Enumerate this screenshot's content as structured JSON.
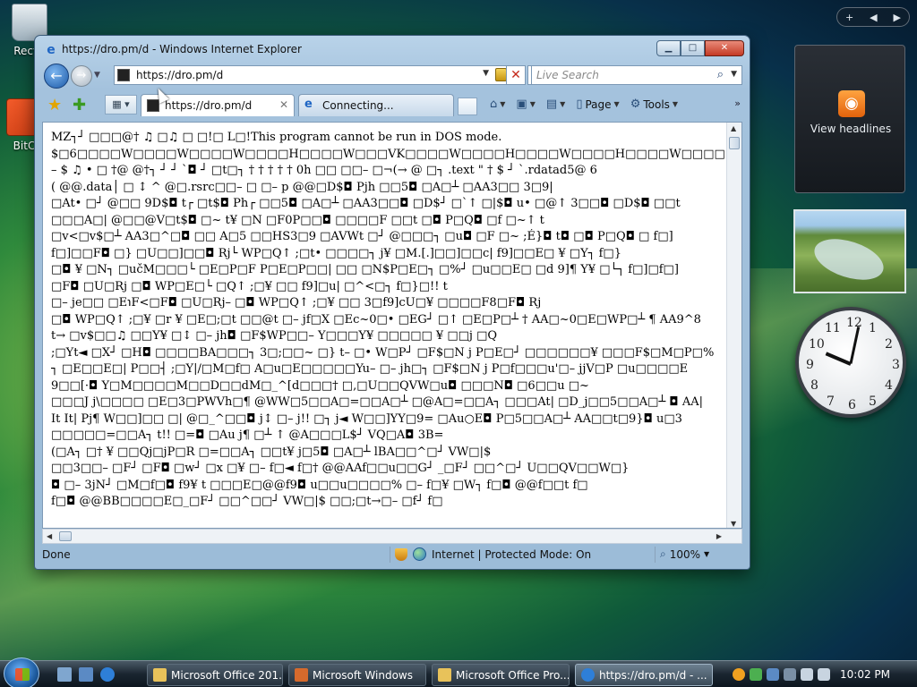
{
  "desktop": {
    "icons": [
      {
        "label": "Recyc"
      },
      {
        "label": "BitC"
      }
    ]
  },
  "ie": {
    "window_title": "https://dro.pm/d - Windows Internet Explorer",
    "address": "https://dro.pm/d",
    "search_placeholder": "Live Search",
    "tabs": [
      {
        "label": "https://dro.pm/d",
        "active": true
      },
      {
        "label": "Connecting...",
        "active": false
      }
    ],
    "commands": {
      "page": "Page",
      "tools": "Tools"
    },
    "status": {
      "text": "Done",
      "zone": "Internet | Protected Mode: On",
      "zoom": "100%"
    },
    "content_lines": [
      "MZ┐┘ □□□@†   ♫   □♫ □ □!□   L□!This program cannot be run in DOS mode.",
      "$□6□□□□W□□□□W□□□□W□□□□H□□□□W□□□VK□□□□W□□□□H□□□□W□□□□H□□□□W□□□□t□□□□W□□□□H□□□□V",
      "   – $   ♫ •  □     †@   @†┐ ┘ ┘ `◘ ┘ □t□┐ † † † † † 0h    □□    □□– □¬(→ @   □┐ .text   \"  † $   ┘  `.rdatad5@   6",
      "(   @@.data│  □   ↕ ^   @□.rsrc□□– □   □– p   @@□D$◘ Pjh   □□5◘  □A□┴  □AA3□□  3□9|",
      "□At• □┘  @□□   9D$◘ t┌ □t$◘ Ph┌ □□5◘  □A□┴  □AA3□□◘  □D$┘  □`↑ □|$◘ u• □@↑     3□□◘  □D$◘  □□t",
      "□□□A□|  @□□@V□t$◘ □~ t¥ □N    □F0P□□◘  □□□□F □□t □◘  P□Q◘   □f □~↑ t",
      "□v<□v$□┴    AA3□^□◘  □□    A□5     □□HS3□9     □AVWt □┘   @□□□┐  □u◘  □F □~ ;É}◘ t◘  □◘  P□Q◘  □    f□]",
      "f□]□□F◘  □}  □U□□]□□◘  Rj└ WP□Q↑ ;□t•  □□□□┐  j¥  □M.[.]□□]□□c|  f9]□□E□     ¥  □Y┐ f□}",
      "□◘  ¥  □N┐  □učM□□□└  □E□P□F P□E□P□□|  □□  □N$P□E□┐ □%┘  □u□□E□     □d     9]¶ Y¥  □└┐ f□]□f□]",
      "□F◘  □U□Rj  □◘  WP□E□└  □Q↑ ;□¥  □□    f9]□u|  □^<□┐ f□}□!! t",
      "□– je□□    □E℩F<□F◘  □U□Rj–  □◘  WP□Q↑ ;□¥  □□    3□f9]cU□¥   □□□□F8□F◘  Rj",
      "□◘  WP□Q↑ ;□¥  □r   ¥  □E□;□t    □□@t  □– jf□X     □Ec~0□•  □EG┘  □↑  □E□P□┴ † AA□~0□E□WP□┴ ¶ AA9^8",
      "t→ □v$□□♫ □□Y¥  □↕     □– jh◘     □F$WP□□– Y□□□Y¥  □□□□□     ¥  □□j □Q",
      "  ;□Yt◄  □X┘   □H◘  □□□□BA□□□┐ 3□;□□~    □}  t– □•  W□P┘   □F$□N    j   P□E□┘    □□□□□□¥   □□□F$□M□P□%",
      "┐ □E□□E□|  P□□┤  ;□Y|/□M□f□    A□u□E□□□□□Yu–  □– jh□┐   □F$□N    j   P□f□□□u'□– jjV□P    □u□□□□E",
      "9□□[·◘     Y□M□□□□M□□D□□dM□_^[d□□□† □,□U□□QVW□u◘   □□□N◘  □6□□u □~",
      "□□□J   j\\□□□□    □E□3□PWVh□¶ @WW□5□□A□=□□A□┴  □@A□=□□A┐  □□□At|  □D_j□□5□□A□┴ ◘  AA|",
      "It   It|  Pj¶ W□□]□□  □|  @□_^□□◘ j↕  □– j!!  □┐ j◄ W□□]YY□9=  □Au○E◘  P□5□□A□┴   AA□□t□9}◘  u□3",
      "□□□□□=□□A┐ t!!  □=◘  □Au j¶  □┴ ↑ @A□□□L$┘  VQ□A◘  3B=",
      "(□A┐  □† ¥  □□Qj□jP□R    □=□□A┐  □□t¥ j□5◘  □A□┴ lBA□□^□┘  VW□|$",
      "□□3□□–  □F┘  □F◘  □w┘  □x    □¥  □–  f□◄ f□† @@AAf□□u□□G┘   _□F┘   □□^□┘   U□□QV□□W□}",
      "◘  □– 3jN┘   □M□f□◘  f9¥  t □□□E□@@f9◘  u□□u□□□□%   □– f□¥  □W┐ f□◘  @@f□□t f□",
      "f□◘  @@BB□□□□E□_□F┘   □□^□□┘  VW□|$ □□;□t→□–  □f┘  f□"
    ]
  },
  "sidebar": {
    "feed_label": "View headlines"
  },
  "taskbar": {
    "buttons": [
      {
        "label": "Microsoft Office 201...",
        "active": false
      },
      {
        "label": "Microsoft Windows",
        "active": false
      },
      {
        "label": "Microsoft Office Pro...",
        "active": false
      },
      {
        "label": "https://dro.pm/d - ...",
        "active": true
      }
    ],
    "clock": "10:02 PM"
  }
}
